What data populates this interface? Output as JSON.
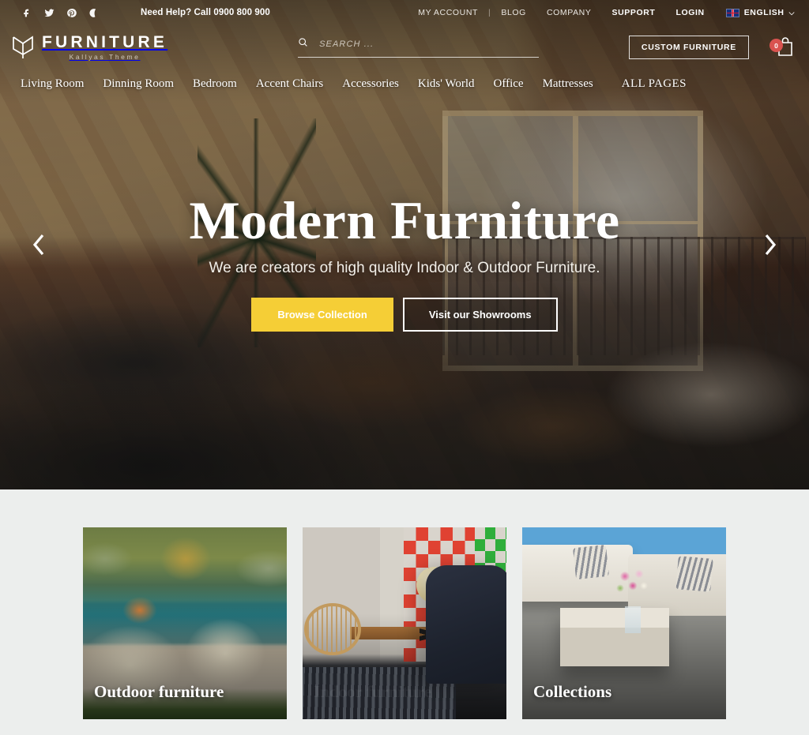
{
  "topbar": {
    "socials": [
      {
        "name": "facebook-icon",
        "label": "Facebook"
      },
      {
        "name": "twitter-icon",
        "label": "Twitter"
      },
      {
        "name": "pinterest-icon",
        "label": "Pinterest"
      },
      {
        "name": "dribbble-icon",
        "label": "Dribbble"
      }
    ],
    "help_text": "Need Help? Call 0900 800 900",
    "links": [
      {
        "label": "MY ACCOUNT",
        "strong": false
      },
      {
        "label": "BLOG",
        "strong": false
      },
      {
        "label": "COMPANY",
        "strong": false
      },
      {
        "label": "SUPPORT",
        "strong": true
      },
      {
        "label": "LOGIN",
        "strong": true
      }
    ],
    "separator": "|",
    "language": "ENGLISH",
    "language_caret": "⌵"
  },
  "brand": {
    "title": "FURNITURE",
    "subtitle": "Kallyas Theme",
    "logo_icon": "chair-logo-icon"
  },
  "search": {
    "placeholder": "SEARCH ...",
    "value": "",
    "icon": "search-icon"
  },
  "header_actions": {
    "custom_furniture_label": "CUSTOM FURNITURE",
    "cart_icon": "shopping-bag-icon",
    "cart_count": "0",
    "cart_badge_color": "#d9534f"
  },
  "nav": {
    "items": [
      {
        "label": "Living Room"
      },
      {
        "label": "Dinning Room"
      },
      {
        "label": "Bedroom"
      },
      {
        "label": "Accent Chairs"
      },
      {
        "label": "Accessories"
      },
      {
        "label": "Kids' World"
      },
      {
        "label": "Office"
      },
      {
        "label": "Mattresses"
      },
      {
        "label": "ALL PAGES"
      }
    ]
  },
  "hero": {
    "title": "Modern Furniture",
    "subtitle": "We are creators of high quality Indoor & Outdoor Furniture.",
    "primary_cta": "Browse Collection",
    "secondary_cta": "Visit our Showrooms",
    "prev_icon": "chevron-left-icon",
    "next_icon": "chevron-right-icon",
    "accent_color": "#F5CE36"
  },
  "categories": {
    "cards": [
      {
        "title": "Outdoor furniture"
      },
      {
        "title": "Indoor furniture"
      },
      {
        "title": "Collections"
      }
    ]
  },
  "theme": {
    "accent": "#F5CE36",
    "section_bg": "#ECEEED",
    "badge": "#d9534f"
  }
}
